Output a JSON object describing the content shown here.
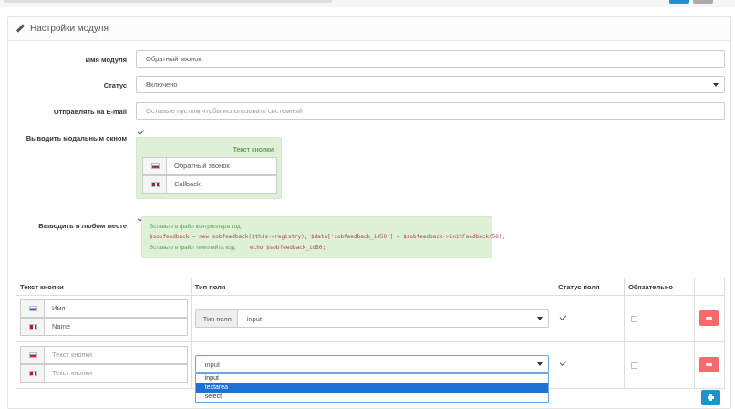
{
  "panel": {
    "title": "Настройки модуля"
  },
  "form": {
    "module_name": {
      "label": "Имя модуля",
      "value": "Обратный звонок"
    },
    "status": {
      "label": "Статус",
      "value": "Включено"
    },
    "email": {
      "label": "Отправлять на E-mail",
      "placeholder": "Оставьте пустым чтобы использовать системный"
    },
    "modal": {
      "label": "Выводить модальным окном",
      "box_title": "Текст кнопки",
      "langs": [
        {
          "flag": "flag-ru-icon",
          "value": "Обратный звонок"
        },
        {
          "flag": "flag-en-icon",
          "value": "Callback"
        }
      ]
    },
    "anywhere": {
      "label": "Выводить в любом месте",
      "hint1": "Вставьте в файл контроллера код:",
      "code1": "$sobfeedback = new sobfeedback($this->registry); $data['sobfeedback_id50'] = $sobfeedback->initFeedback(50);",
      "hint2": "Вставьте в файл темплейта код:",
      "code2": "echo $sobfeedback_id50;"
    }
  },
  "table": {
    "headers": [
      "Текст кнопки",
      "Тип поля",
      "Статус поля",
      "Обязательно",
      ""
    ],
    "rows": [
      {
        "langs": [
          {
            "flag": "flag-ru-icon",
            "value": "Имя",
            "placeholder": false
          },
          {
            "flag": "flag-en-icon",
            "value": "Name",
            "placeholder": false
          }
        ],
        "type_label": "Тип поля",
        "type_value": "input"
      },
      {
        "langs": [
          {
            "flag": "flag-ru-icon",
            "value": "Текст кнопки",
            "placeholder": true
          },
          {
            "flag": "flag-en-icon",
            "value": "Текст кнопки",
            "placeholder": true
          }
        ],
        "type_value": "input",
        "dropdown_options": [
          "input",
          "textarea",
          "select"
        ],
        "dropdown_active": "textarea"
      }
    ]
  },
  "colors": {
    "primary": "#1e91cf",
    "danger": "#f56b6b",
    "success_bg": "#dff0d8",
    "success_text": "#5aa152",
    "code_text": "#a94442",
    "dropdown_highlight": "#1e6fd6"
  }
}
